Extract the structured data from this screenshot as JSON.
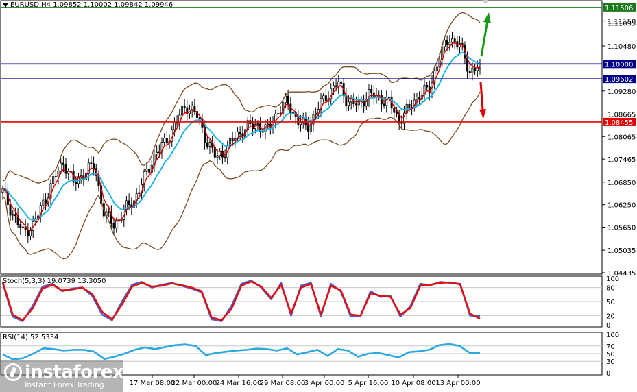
{
  "header": {
    "symbol_line": "EURUSD,H4  1.09852 1.10002 1.09842 1.09946"
  },
  "colors": {
    "background": "#ffffff",
    "grid": "#c8c8c8",
    "candle": "#000000",
    "ema_fast": "#d40000",
    "ema_slow": "#1fb4e6",
    "bollinger": "#7a4a1e",
    "resistance": "#1b7a1b",
    "pivot": "#00008b",
    "support": "#e60000",
    "arrow_up": "#169b16",
    "arrow_down": "#e00000",
    "stoch_main": "#4a5ed6",
    "stoch_signal": "#e01010",
    "rsi": "#2aa8e0"
  },
  "chart_data": [
    {
      "type": "candlestick",
      "title": "EURUSD,H4",
      "ohlc_last": {
        "open": 1.09852,
        "high": 1.10002,
        "low": 1.09842,
        "close": 1.09946
      },
      "ylim": [
        1.04435,
        1.1165
      ],
      "y_ticks": [
        "1.11150",
        "1.11095",
        "1.10480",
        "1.10000",
        "1.09602",
        "1.09280",
        "1.08665",
        "1.08455",
        "1.08065",
        "1.07465",
        "1.06850",
        "1.06250",
        "1.05650",
        "1.05035",
        "1.04435"
      ],
      "x_ticks": [
        "17 Mar 08:00",
        "22 Mar 00:00",
        "24 Mar 16:00",
        "29 Mar 08:00",
        "3 Apr 00:00",
        "5 Apr 16:00",
        "10 Apr 08:00",
        "13 Apr 00:00"
      ],
      "close_anchors": [
        1.066,
        1.06,
        1.055,
        1.057,
        1.063,
        1.069,
        1.074,
        1.068,
        1.071,
        1.073,
        1.06,
        1.057,
        1.061,
        1.064,
        1.07,
        1.076,
        1.079,
        1.084,
        1.089,
        1.087,
        1.08,
        1.075,
        1.077,
        1.081,
        1.083,
        1.084,
        1.082,
        1.087,
        1.09,
        1.085,
        1.083,
        1.088,
        1.092,
        1.095,
        1.09,
        1.089,
        1.092,
        1.091,
        1.09,
        1.085,
        1.088,
        1.092,
        1.093,
        1.102,
        1.107,
        1.105,
        1.098,
        1.0995
      ],
      "horizontal_lines": [
        {
          "label": "1.11506",
          "value": 1.11506,
          "role": "resistance"
        },
        {
          "label": "1.10000",
          "value": 1.1,
          "role": "pivot"
        },
        {
          "label": "1.09602",
          "value": 1.09602,
          "role": "pivot"
        },
        {
          "label": "1.08455",
          "value": 1.08455,
          "role": "support"
        }
      ]
    },
    {
      "type": "line",
      "title": "Stoch(5,3,3) 19.0739 13.3050",
      "ylim": [
        0,
        100
      ],
      "y_ticks": [
        "100",
        "80",
        "50",
        "20",
        "0"
      ],
      "levels": [
        20,
        50,
        80
      ],
      "series": [
        {
          "name": "main",
          "value_last": 19.0739,
          "values": [
            90,
            18,
            8,
            40,
            82,
            88,
            72,
            78,
            80,
            62,
            22,
            10,
            50,
            86,
            92,
            80,
            86,
            90,
            84,
            78,
            70,
            12,
            8,
            40,
            88,
            95,
            80,
            55,
            90,
            20,
            84,
            90,
            18,
            88,
            72,
            18,
            20,
            72,
            60,
            62,
            18,
            40,
            88,
            85,
            92,
            90,
            88,
            20,
            19.07
          ]
        },
        {
          "name": "signal",
          "value_last": 13.305,
          "values": [
            92,
            22,
            10,
            35,
            78,
            86,
            74,
            76,
            80,
            66,
            28,
            12,
            44,
            82,
            90,
            82,
            84,
            89,
            85,
            80,
            72,
            16,
            10,
            34,
            84,
            93,
            82,
            58,
            86,
            24,
            80,
            88,
            22,
            84,
            74,
            22,
            20,
            68,
            62,
            60,
            22,
            36,
            84,
            86,
            90,
            91,
            87,
            24,
            13.31
          ]
        }
      ]
    },
    {
      "type": "line",
      "title": "RSI(14) 52.5334",
      "ylim": [
        0,
        100
      ],
      "y_ticks": [
        "100",
        "70",
        "50",
        "30",
        "0"
      ],
      "levels": [
        30,
        50,
        70
      ],
      "series": [
        {
          "name": "rsi",
          "value_last": 52.5334,
          "values": [
            48,
            35,
            38,
            50,
            64,
            62,
            58,
            60,
            60,
            55,
            36,
            42,
            50,
            60,
            66,
            62,
            67,
            72,
            74,
            70,
            46,
            52,
            55,
            58,
            60,
            63,
            62,
            58,
            64,
            48,
            54,
            60,
            44,
            62,
            58,
            42,
            50,
            52,
            46,
            40,
            54,
            56,
            60,
            72,
            75,
            70,
            52,
            52.53
          ]
        }
      ]
    }
  ],
  "watermark": {
    "brand": "instaforex",
    "tagline": "Instant Forex Trading"
  }
}
